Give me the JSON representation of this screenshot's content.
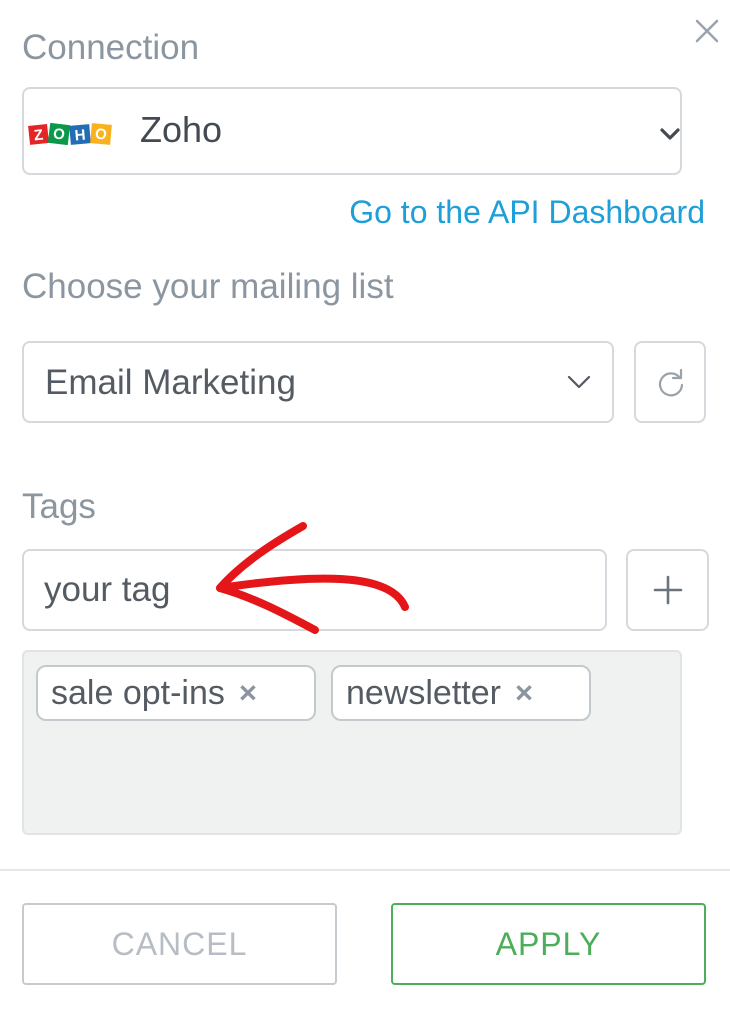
{
  "connection": {
    "label": "Connection",
    "selected_value": "Zoho",
    "logo_icon": "zoho-logo",
    "api_link": "Go to the API Dashboard"
  },
  "mailing_list": {
    "label": "Choose your mailing list",
    "selected_value": "Email Marketing",
    "refresh_icon": "refresh-icon"
  },
  "tags": {
    "label": "Tags",
    "input_value": "your tag",
    "add_icon": "plus-icon",
    "chips": [
      {
        "label": "sale opt-ins",
        "remove": "×"
      },
      {
        "label": "newsletter",
        "remove": "×"
      }
    ]
  },
  "footer": {
    "cancel_label": "CANCEL",
    "apply_label": "APPLY"
  },
  "colors": {
    "link": "#1e9fd9",
    "apply": "#4cae5a",
    "annotation_arrow": "#e5161a",
    "label": "#8b96a1"
  }
}
